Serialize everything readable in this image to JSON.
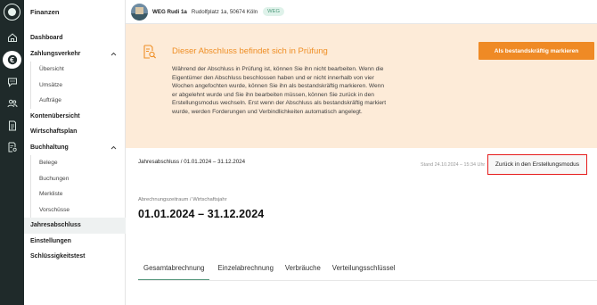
{
  "sidebar": {
    "title": "Finanzen",
    "items": [
      {
        "label": "Dashboard"
      },
      {
        "label": "Zahlungsverkehr"
      },
      {
        "label": "Übersicht"
      },
      {
        "label": "Umsätze"
      },
      {
        "label": "Aufträge"
      },
      {
        "label": "Kontenübersicht"
      },
      {
        "label": "Wirtschaftsplan"
      },
      {
        "label": "Buchhaltung"
      },
      {
        "label": "Belege"
      },
      {
        "label": "Buchungen"
      },
      {
        "label": "Merkliste"
      },
      {
        "label": "Vorschüsse"
      },
      {
        "label": "Jahresabschluss"
      },
      {
        "label": "Einstellungen"
      },
      {
        "label": "Schlüssigkeitstest"
      }
    ]
  },
  "rail_icons": [
    "app-logo-icon",
    "home-icon",
    "finance-euro-icon",
    "chat-icon",
    "people-icon",
    "document-icon",
    "document-settings-icon"
  ],
  "topbar": {
    "property_name": "WEG Rudi 1a",
    "address": "Rudolfplatz 1a, 50674 Köln",
    "badge": "WEG"
  },
  "banner": {
    "title": "Dieser Abschluss befindet sich in Prüfung",
    "text": "Während der Abschluss in Prüfung ist, können Sie ihn nicht bearbeiten. Wenn die Eigentümer den Abschluss beschlossen haben und er nicht innerhalb von vier Wochen angefochten wurde, können Sie ihn als bestandskräftig markieren. Wenn er abgelehnt wurde und Sie ihn bearbeiten müssen, können Sie zurück in den Erstellungsmodus wechseln. Erst wenn der Abschluss als bestandskräftig markiert wurde, werden Forderungen und Verbindlichkeiten automatisch angelegt.",
    "button": "Als bestandskräftig markieren"
  },
  "content": {
    "breadcrumb": "Jahresabschluss  /  01.01.2024 – 31.12.2024",
    "stand": "Stand 24.10.2024 – 15:34 Uhr",
    "return_button": "Zurück in den Erstellungsmodus",
    "period_label": "Abrechnungszeitraum / Wirtschaftsjahr",
    "period": "01.01.2024 – 31.12.2024",
    "tabs": [
      {
        "label": "Gesamtabrechnung"
      },
      {
        "label": "Einzelabrechnung"
      },
      {
        "label": "Verbräuche"
      },
      {
        "label": "Verteilungsschlüssel"
      }
    ]
  },
  "colors": {
    "accent_orange": "#ef8a25",
    "banner_bg": "#fdebd8",
    "rail_bg": "#1f2a2a",
    "tab_underline": "#5b9a80",
    "highlight_red": "#e61c1c"
  }
}
